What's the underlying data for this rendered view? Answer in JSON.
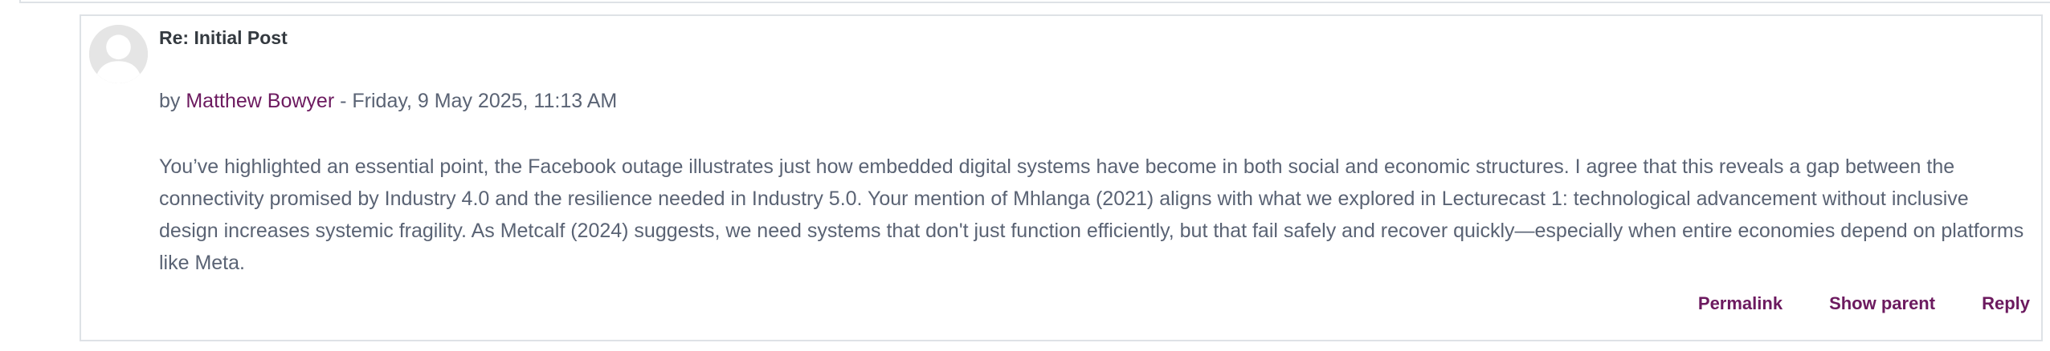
{
  "post": {
    "subject": "Re: Initial Post",
    "byline": {
      "prefix": "by",
      "author": "Matthew Bowyer",
      "separator": "-",
      "date": "Friday, 9 May 2025, 11:13 AM"
    },
    "body": "You’ve highlighted an essential point, the Facebook outage illustrates just how embedded digital systems have become in both social and economic structures. I agree that this reveals a gap between the connectivity promised by Industry 4.0 and the resilience needed in Industry 5.0. Your mention of Mhlanga (2021) aligns with what we explored in Lecturecast 1: technological advancement without inclusive design increases systemic fragility. As Metcalf (2024) suggests, we need systems that don't just function efficiently, but that fail safely and recover quickly—especially when entire economies depend on platforms like Meta.",
    "avatar_icon": "default-user-avatar-icon",
    "actions": {
      "permalink": "Permalink",
      "show_parent": "Show parent",
      "reply": "Reply"
    }
  },
  "colors": {
    "link": "#6c1a5f",
    "text": "#5a6374",
    "heading": "#343a40",
    "border": "#dee2e6",
    "avatar_bg": "#e5e5e5"
  }
}
